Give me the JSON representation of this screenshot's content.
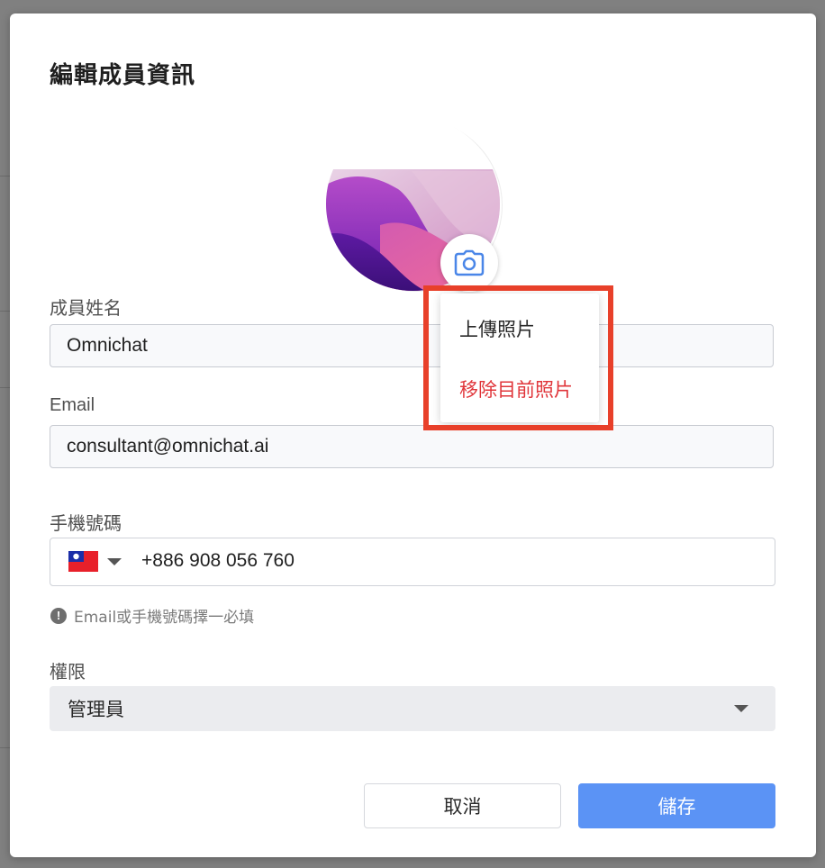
{
  "modal": {
    "title": "編輯成員資訊"
  },
  "avatar": {
    "camera_icon": "camera-icon"
  },
  "photo_menu": {
    "upload_label": "上傳照片",
    "remove_label": "移除目前照片"
  },
  "form": {
    "name": {
      "label": "成員姓名",
      "value": "Omnichat"
    },
    "email": {
      "label": "Email",
      "value": "consultant@omnichat.ai"
    },
    "phone": {
      "label": "手機號碼",
      "country_flag_icon": "taiwan-flag-icon",
      "value": "+886 908 056 760"
    },
    "hint": {
      "icon": "exclamation-circle-icon",
      "text": "Email或手機號碼擇一必填"
    },
    "role": {
      "label": "權限",
      "value": "管理員"
    }
  },
  "buttons": {
    "cancel_label": "取消",
    "save_label": "儲存"
  },
  "colors": {
    "primary": "#5b93f5",
    "danger": "#e0353a",
    "highlight": "#e8402a"
  }
}
